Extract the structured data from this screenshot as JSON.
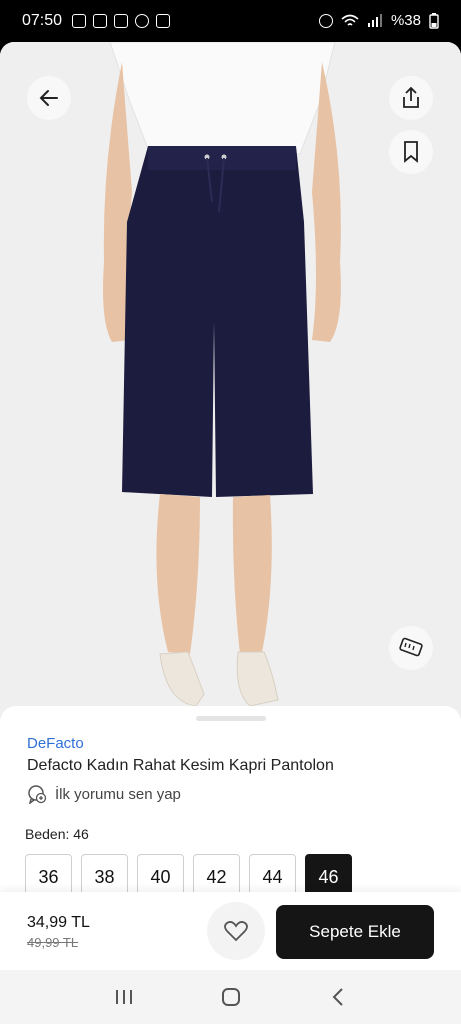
{
  "status_bar": {
    "time": "07:50",
    "battery": "%38",
    "left_icons": [
      "cast-icon",
      "notification-icon",
      "instagram-icon",
      "messenger-icon",
      "gallery-icon"
    ],
    "right_icons": [
      "alarm-icon",
      "wifi-icon",
      "volte-icon",
      "signal-icon"
    ]
  },
  "product": {
    "brand": "DeFacto",
    "title": "Defacto Kadın Rahat Kesim Kapri Pantolon",
    "review_prompt": "İlk yorumu sen yap",
    "size_label": "Beden: 46",
    "sizes": [
      "36",
      "38",
      "40",
      "42",
      "44",
      "46"
    ],
    "selected_size": "46",
    "price": "34,99 TL",
    "old_price": "49,99 TL"
  },
  "actions": {
    "add_to_cart": "Sepete Ekle"
  },
  "colors": {
    "brand_link": "#2f6fd6",
    "primary_button": "#151515",
    "pants": "#1c1c3f"
  }
}
